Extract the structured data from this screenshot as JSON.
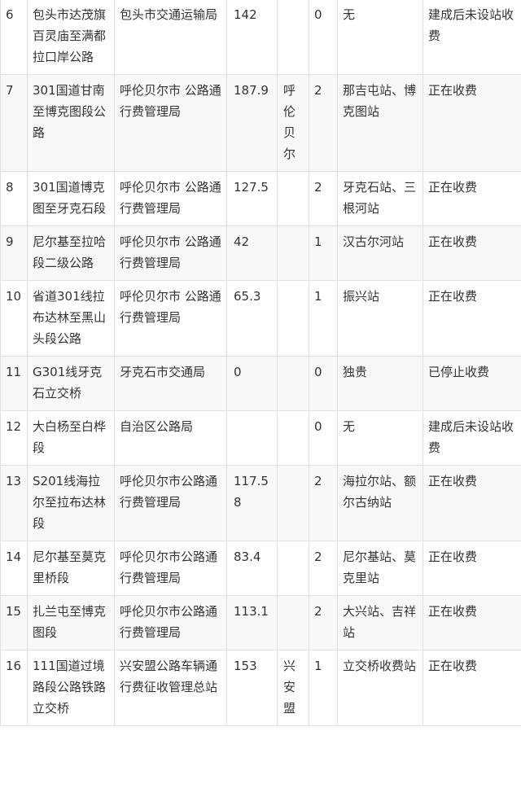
{
  "rows": [
    {
      "no": "6",
      "road": "包头市达茂旗百灵庙至满都拉口岸公路",
      "unit": "包头市交通运输局",
      "length": "142",
      "region": "",
      "stations_count": "0",
      "stations": "无",
      "status": "建成后未设站收费"
    },
    {
      "no": "7",
      "road": "301国道甘南至博克图段公路",
      "unit": "呼伦贝尔市 公路通行费管理局",
      "length": "187.9",
      "region": "呼伦贝尔",
      "stations_count": "2",
      "stations": "那吉屯站、博克图站",
      "status": "正在收费"
    },
    {
      "no": "8",
      "road": "301国道博克图至牙克石段",
      "unit": "呼伦贝尔市 公路通行费管理局",
      "length": "127.5",
      "region": "",
      "stations_count": "2",
      "stations": "牙克石站、三根河站",
      "status": "正在收费"
    },
    {
      "no": "9",
      "road": "尼尔基至拉哈段二级公路",
      "unit": "呼伦贝尔市 公路通行费管理局",
      "length": "42",
      "region": "",
      "stations_count": "1",
      "stations": "汉古尔河站",
      "status": "正在收费"
    },
    {
      "no": "10",
      "road": "省道301线拉布达林至黑山头段公路",
      "unit": "呼伦贝尔市 公路通行费管理局",
      "length": "65.3",
      "region": "",
      "stations_count": "1",
      "stations": "振兴站",
      "status": "正在收费"
    },
    {
      "no": "11",
      "road": "G301线牙克石立交桥",
      "unit": "牙克石市交通局",
      "length": "0",
      "region": "",
      "stations_count": "0",
      "stations": "独贵",
      "status": "已停止收费"
    },
    {
      "no": "12",
      "road": "大白杨至白桦段",
      "unit": "自治区公路局",
      "length": "",
      "region": "",
      "stations_count": "0",
      "stations": "无",
      "status": "建成后未设站收费"
    },
    {
      "no": "13",
      "road": "S201线海拉尔至拉布达林段",
      "unit": "呼伦贝尔市公路通行费管理局",
      "length": "117.58",
      "region": "",
      "stations_count": "2",
      "stations": "海拉尔站、额尔古纳站",
      "status": "正在收费"
    },
    {
      "no": "14",
      "road": "尼尔基至莫克里桥段",
      "unit": "呼伦贝尔市公路通行费管理局",
      "length": "83.4",
      "region": "",
      "stations_count": "2",
      "stations": "尼尔基站、莫克里站",
      "status": "正在收费"
    },
    {
      "no": "15",
      "road": "扎兰屯至博克图段",
      "unit": "呼伦贝尔市公路通行费管理局",
      "length": "113.1",
      "region": "",
      "stations_count": "2",
      "stations": "大兴站、吉祥站",
      "status": "正在收费"
    },
    {
      "no": "16",
      "road": "111国道过境路段公路铁路立交桥",
      "unit": "兴安盟公路车辆通行费征收管理总站",
      "length": "153",
      "region": "兴安盟",
      "stations_count": "1",
      "stations": "立交桥收费站",
      "status": "正在收费"
    }
  ]
}
